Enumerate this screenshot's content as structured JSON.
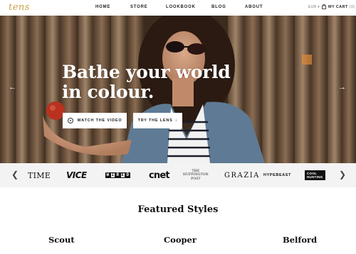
{
  "brand": {
    "logo": "tens",
    "accent_color": "#c9a24a"
  },
  "nav": {
    "items": [
      {
        "label": "HOME"
      },
      {
        "label": "STORE"
      },
      {
        "label": "LOOKBOOK"
      },
      {
        "label": "BLOG"
      },
      {
        "label": "ABOUT"
      }
    ],
    "currency": "EUR ▾",
    "cart_label": "MY CART",
    "cart_count": "(0)",
    "cart_icon": "shopping-bag-icon"
  },
  "hero": {
    "headline": "Bathe your world in colour.",
    "prev_icon": "arrow-left-icon",
    "next_icon": "arrow-right-icon",
    "watch_video_label": "WATCH THE VIDEO",
    "watch_video_icon": "play-icon",
    "try_lens_label": "TRY THE LENS",
    "try_lens_icon": "arrow-down-icon"
  },
  "press": {
    "prev_icon": "chevron-left-icon",
    "next_icon": "chevron-right-icon",
    "logos": {
      "time": "TIME",
      "vice": "VICE",
      "wired": "WIRED",
      "cnet": "cnet",
      "huffpost_line1": "THE",
      "huffpost_line2": "HUFFINGTON",
      "huffpost_line3": "POST",
      "grazia": "GRAZIA",
      "hypebeast": "HYPEBEAST",
      "coolhunting_line1": "COOL",
      "coolhunting_line2": "HUNTING"
    }
  },
  "featured": {
    "title": "Featured Styles",
    "styles": [
      {
        "name": "Scout"
      },
      {
        "name": "Cooper"
      },
      {
        "name": "Belford"
      }
    ]
  }
}
